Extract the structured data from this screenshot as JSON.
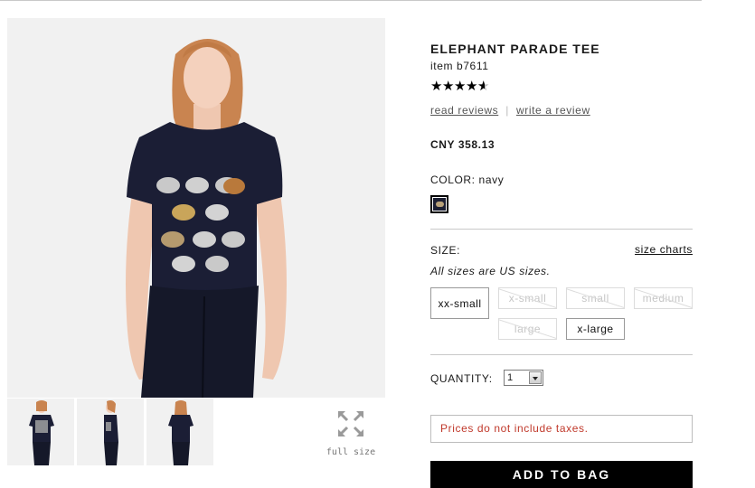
{
  "product": {
    "title": "ELEPHANT PARADE TEE",
    "item_number": "item b7611",
    "rating": 4.5,
    "rating_max": 5,
    "read_reviews": "read reviews",
    "write_review": "write a review",
    "review_separator": "|",
    "price": "CNY 358.13"
  },
  "color": {
    "label": "COLOR:",
    "selected": "navy",
    "swatch_hex": "#1c1f33"
  },
  "size": {
    "label": "SIZE:",
    "charts_link": "size charts",
    "note": "All sizes are US sizes.",
    "options": [
      {
        "label": "xx-small",
        "available": true
      },
      {
        "label": "x-small",
        "available": false
      },
      {
        "label": "small",
        "available": false
      },
      {
        "label": "medium",
        "available": false
      },
      {
        "label": "large",
        "available": false
      },
      {
        "label": "x-large",
        "available": true
      }
    ]
  },
  "quantity": {
    "label": "QUANTITY:",
    "selected": "1"
  },
  "tax_notice": "Prices do not include taxes.",
  "add_to_bag": "ADD TO BAG",
  "gallery": {
    "full_size_label": "full size",
    "thumbnails": [
      "front-view",
      "side-view",
      "back-view"
    ],
    "main_view": "front-view",
    "icon": "expand-arrows-icon"
  },
  "colors": {
    "accent": "#000000",
    "notice_text": "#c0392b",
    "tee": "#1b1e35",
    "background": "#f1f1f1"
  }
}
